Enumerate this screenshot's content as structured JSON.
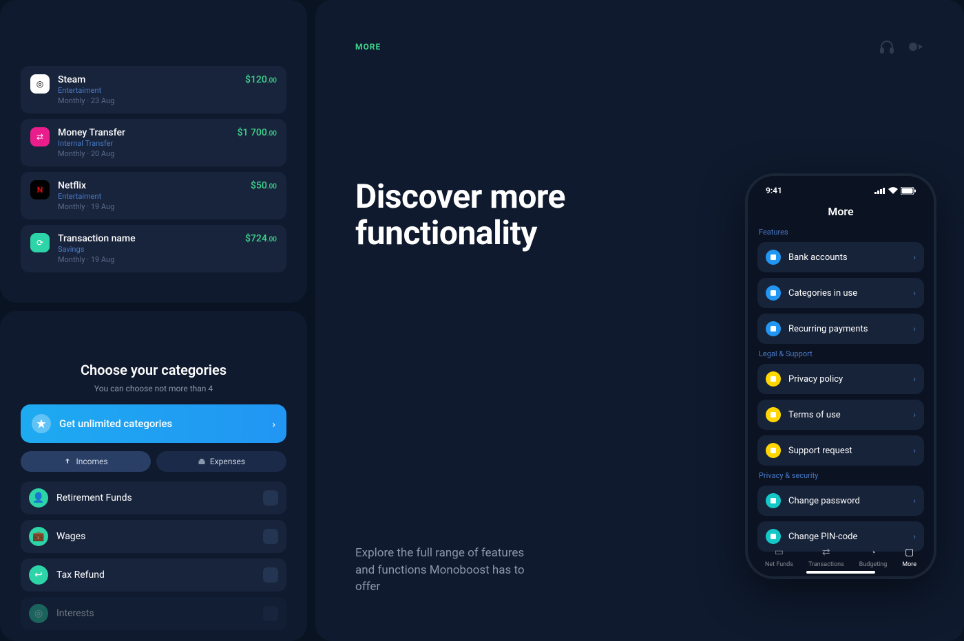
{
  "left": {
    "transactions": [
      {
        "name": "Steam",
        "category": "Entertaiment",
        "freq": "Monthly · 23 Aug",
        "amount": "$120",
        "cents": ".00",
        "icon": "steam"
      },
      {
        "name": "Money Transfer",
        "category": "Internal Transfer",
        "freq": "Monthly · 20 Aug",
        "amount": "$1 700",
        "cents": ".00",
        "icon": "money"
      },
      {
        "name": "Netflix",
        "category": "Entertaiment",
        "freq": "Monthly · 19 Aug",
        "amount": "$50",
        "cents": ".00",
        "icon": "netflix"
      },
      {
        "name": "Transaction name",
        "category": "Savings",
        "freq": "Monthly · 19 Aug",
        "amount": "$724",
        "cents": ".00",
        "icon": "savings"
      }
    ],
    "categoriesPanel": {
      "title": "Choose your categories",
      "subtitle": "You can choose not more than 4",
      "unlimited": "Get unlimited categories",
      "seg_incomes": "Incomes",
      "seg_expenses": "Expenses",
      "items": [
        {
          "label": "Retirement Funds"
        },
        {
          "label": "Wages"
        },
        {
          "label": "Tax Refund"
        },
        {
          "label": "Interests"
        }
      ]
    }
  },
  "right": {
    "header": "MORE",
    "title": "Discover more\nfunctionality",
    "subtitle": "Explore the full range of features and functions Monoboost has to offer"
  },
  "phone": {
    "time": "9:41",
    "title": "More",
    "sections": [
      {
        "label": "Features",
        "color": "blue",
        "items": [
          "Bank accounts",
          "Categories in use",
          "Recurring payments"
        ]
      },
      {
        "label": "Legal & Support",
        "color": "yellow",
        "items": [
          "Privacy policy",
          "Terms of use",
          "Support request"
        ]
      },
      {
        "label": "Privacy & security",
        "color": "teal",
        "items": [
          "Change password",
          "Change PIN-code"
        ]
      }
    ],
    "tabs": [
      "Net Funds",
      "Transactions",
      "Budgeting",
      "More"
    ]
  }
}
